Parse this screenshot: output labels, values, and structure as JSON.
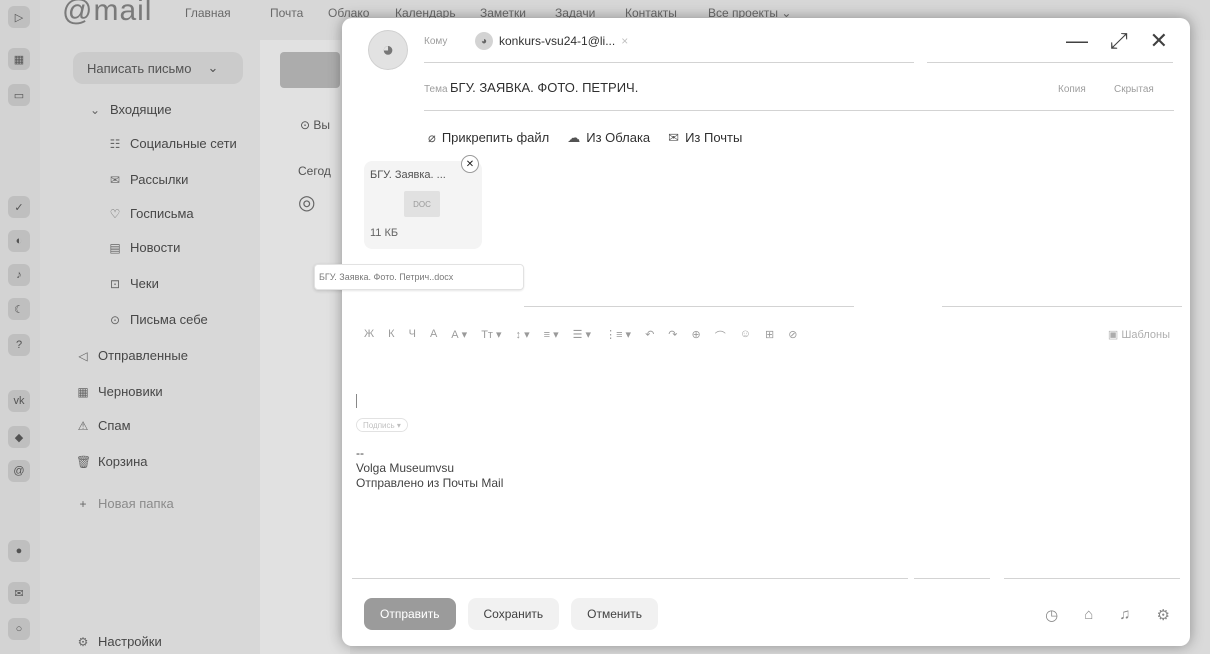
{
  "app": {
    "logo": "@mail",
    "nav": [
      "Главная",
      "Почта",
      "Облако",
      "Календарь",
      "Заметки",
      "Задачи",
      "Контакты",
      "Все проекты ⌄"
    ]
  },
  "sidebar": {
    "compose": "Написать письмо",
    "folders": [
      {
        "icon": "⌄",
        "label": "Входящие"
      },
      {
        "icon": "☷",
        "label": "Социальные сети"
      },
      {
        "icon": "✉",
        "label": "Рассылки"
      },
      {
        "icon": "♡",
        "label": "Госписьма"
      },
      {
        "icon": "▤",
        "label": "Новости"
      },
      {
        "icon": "⊡",
        "label": "Чеки"
      },
      {
        "icon": "⊙",
        "label": "Письма себе"
      },
      {
        "icon": "◁",
        "label": "Отправленные"
      },
      {
        "icon": "▦",
        "label": "Черновики"
      },
      {
        "icon": "⚠",
        "label": "Спам"
      },
      {
        "icon": "🗑",
        "label": "Корзина"
      },
      {
        "icon": "+",
        "label": "Новая папка"
      }
    ],
    "settings": "Настройки"
  },
  "middle": {
    "item1": "Вы",
    "today": "Сегод"
  },
  "compose": {
    "to_label": "Кому",
    "to_value": "konkurs-vsu24-1@li...",
    "subject_label": "Тема",
    "subject_value": "БГУ. ЗАЯВКА. ФОТО. ПЕТРИЧ.",
    "copy_label": "Копия",
    "hidden_label": "Скрытая",
    "attach_file": "Прикрепить файл",
    "from_cloud": "Из Облака",
    "from_mail": "Из Почты",
    "attachment": {
      "name": "БГУ. Заявка. ...",
      "size": "11 КБ",
      "tooltip": "БГУ. Заявка. Фото. Петрич..docx"
    },
    "toolbar_items": [
      "Ж",
      "К",
      "Ч",
      "А",
      "А ▾",
      "Тт ▾",
      "↕ ▾",
      "≡ ▾",
      "☰ ▾",
      "⋮≡ ▾",
      "↶",
      "↷",
      "⊕",
      "⌒",
      "☺",
      "⊞",
      "⊘"
    ],
    "template": "Шаблоны",
    "signature_chip": "Подпись ▾",
    "body_lines": [
      "--",
      "Volga Museumvsu",
      "Отправлено из Почты Mail"
    ],
    "send": "Отправить",
    "save": "Сохранить",
    "cancel": "Отменить"
  },
  "colors": {
    "background": "#d9d9d9",
    "modal": "#ffffff",
    "primary_button": "#9a9a9a"
  }
}
